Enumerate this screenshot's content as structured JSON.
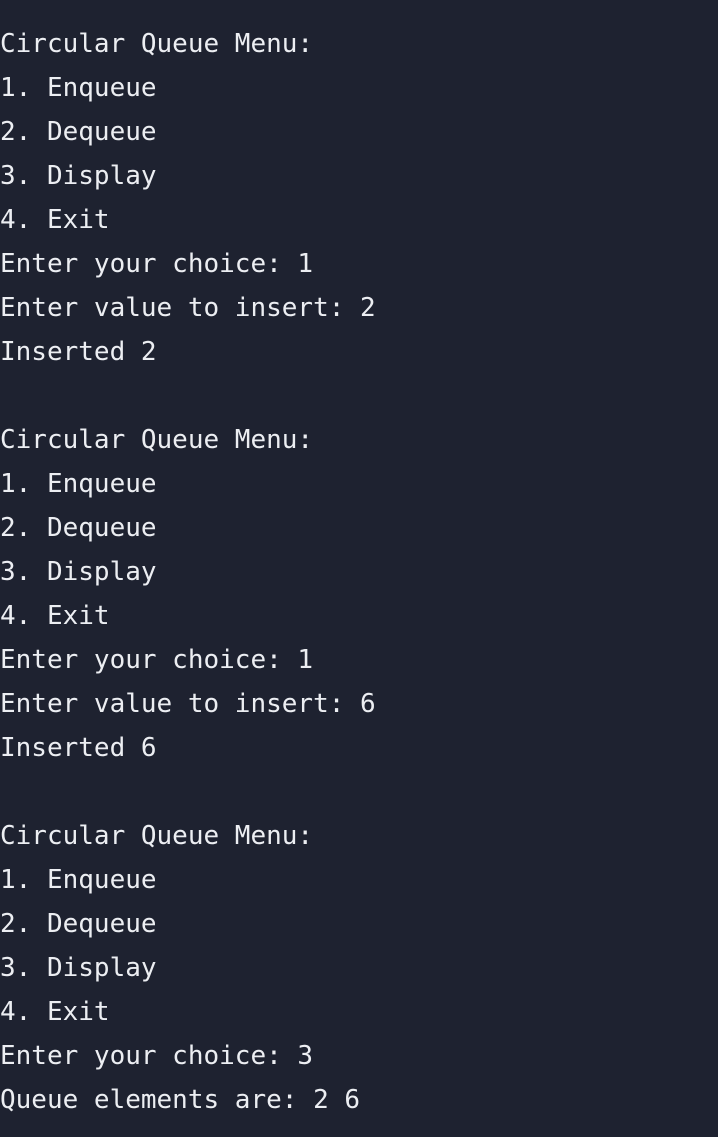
{
  "terminal": {
    "background_color": "#1e2230",
    "text_color": "#eceef2",
    "lines": [
      "Circular Queue Menu:",
      "1. Enqueue",
      "2. Dequeue",
      "3. Display",
      "4. Exit",
      "Enter your choice: 1",
      "Enter value to insert: 2",
      "Inserted 2",
      "",
      "Circular Queue Menu:",
      "1. Enqueue",
      "2. Dequeue",
      "3. Display",
      "4. Exit",
      "Enter your choice: 1",
      "Enter value to insert: 6",
      "Inserted 6",
      "",
      "Circular Queue Menu:",
      "1. Enqueue",
      "2. Dequeue",
      "3. Display",
      "4. Exit",
      "Enter your choice: 3",
      "Queue elements are: 2 6"
    ]
  }
}
